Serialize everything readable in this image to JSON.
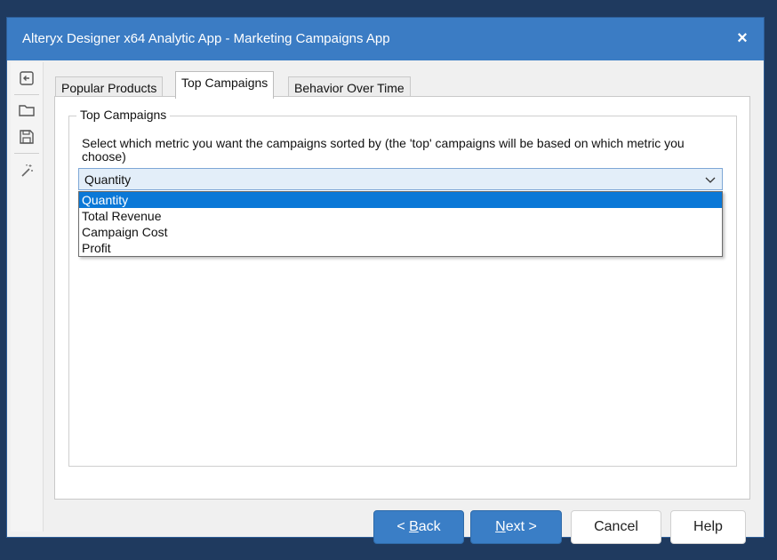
{
  "window": {
    "title": "Alteryx Designer x64 Analytic App - Marketing Campaigns App",
    "close_glyph": "×"
  },
  "sidebar": {
    "icons": [
      "back-arrow-icon",
      "folder-open-icon",
      "save-icon",
      "magic-wand-icon"
    ]
  },
  "tabs": [
    {
      "label": "Popular Products",
      "active": false
    },
    {
      "label": "Top Campaigns",
      "active": true
    },
    {
      "label": "Behavior Over Time",
      "active": false
    }
  ],
  "panel": {
    "group_title": "Top Campaigns",
    "description": "Select which metric you want the campaigns sorted by (the 'top' campaigns will be based on which metric you choose)",
    "select": {
      "value": "Quantity",
      "options": [
        "Quantity",
        "Total Revenue",
        "Campaign Cost",
        "Profit"
      ]
    }
  },
  "buttons": {
    "back_prefix": "< ",
    "back_accel": "B",
    "back_rest": "ack",
    "next_accel": "N",
    "next_rest": "ext >",
    "cancel": "Cancel",
    "help": "Help"
  },
  "colors": {
    "titlebar": "#3b7cc4",
    "primary_button": "#3a7ec6",
    "selected_option": "#0a78d7",
    "background": "#1f3a5f"
  }
}
